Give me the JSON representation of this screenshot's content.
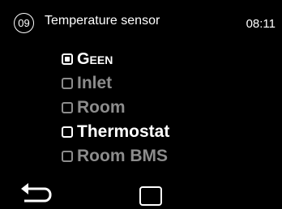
{
  "header": {
    "screen_number": "09",
    "title": "Temperature sensor",
    "time": "08:11"
  },
  "options": [
    {
      "label": "Geen",
      "state": "selected",
      "checked": true
    },
    {
      "label": "Inlet",
      "state": "disabled",
      "checked": false
    },
    {
      "label": "Room",
      "state": "disabled",
      "checked": false
    },
    {
      "label": "Thermostat",
      "state": "enabled",
      "checked": false
    },
    {
      "label": "Room BMS",
      "state": "disabled",
      "checked": false
    }
  ],
  "footer": {
    "back_icon": "back-arrow-icon",
    "home_icon": "square-home-icon"
  },
  "colors": {
    "background": "#000000",
    "text": "#ffffff",
    "disabled": "#8c8c8c"
  }
}
